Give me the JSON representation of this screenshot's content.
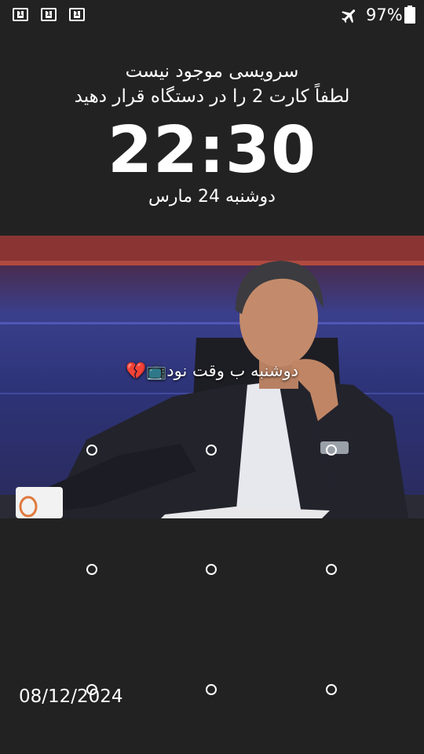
{
  "status_bar": {
    "notifications": [
      "1",
      "1",
      "1"
    ],
    "airplane_mode_icon": "airplane-icon",
    "battery_percent": "97%",
    "battery_icon": "battery-icon"
  },
  "lock_screen": {
    "sim_line_1": "سرویسی موجود نیست",
    "sim_line_2": "لطفاً کارت 2 را در دستگاه قرار دهید",
    "time": "22:30",
    "date": "دوشنبه 24 مارس",
    "owner_info": "دوشنبه ب وقت نود📺💔",
    "footer_date": "08/12/2024"
  },
  "pattern": {
    "dot_count": 9,
    "dot_color": "#ffffff"
  },
  "colors": {
    "background": "#232223",
    "text": "#ffffff"
  }
}
